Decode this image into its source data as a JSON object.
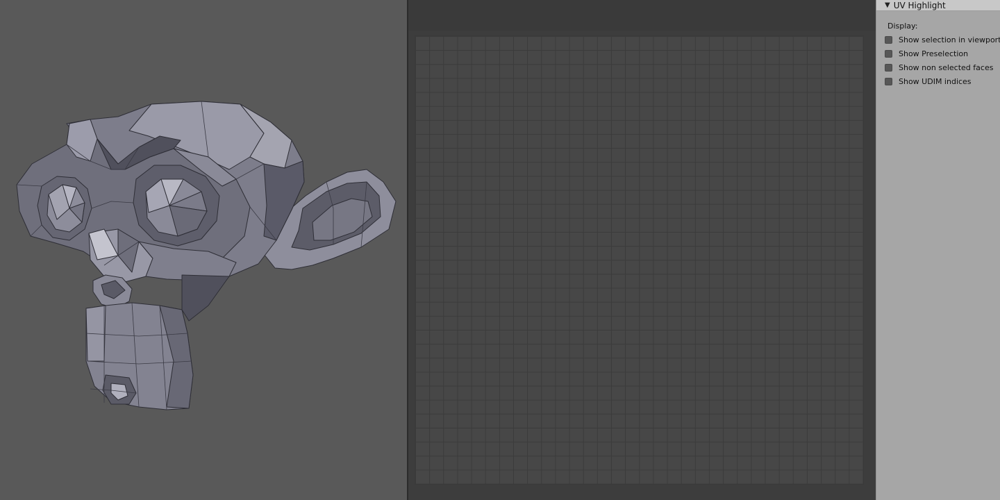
{
  "panel": {
    "title": "UV Highlight",
    "display_label": "Display:",
    "options": [
      {
        "label": "Show selection in viewport",
        "checked": false
      },
      {
        "label": "Show Preselection",
        "checked": false
      },
      {
        "label": "Show non selected faces",
        "checked": false
      },
      {
        "label": "Show UDIM indices",
        "checked": false
      }
    ]
  },
  "icons": {
    "panel_collapse": "triangle-down-icon",
    "viewport_object": "monkey-mesh-icon"
  },
  "colors": {
    "viewport_bg": "#595959",
    "uv_bg": "#3d3d3d",
    "uv_grid": "#474747",
    "sidebar_bg": "#a6a6a6",
    "mesh_light": "#8c8c9a",
    "mesh_dark": "#4a4a55",
    "mesh_edge": "#2e2e36"
  }
}
